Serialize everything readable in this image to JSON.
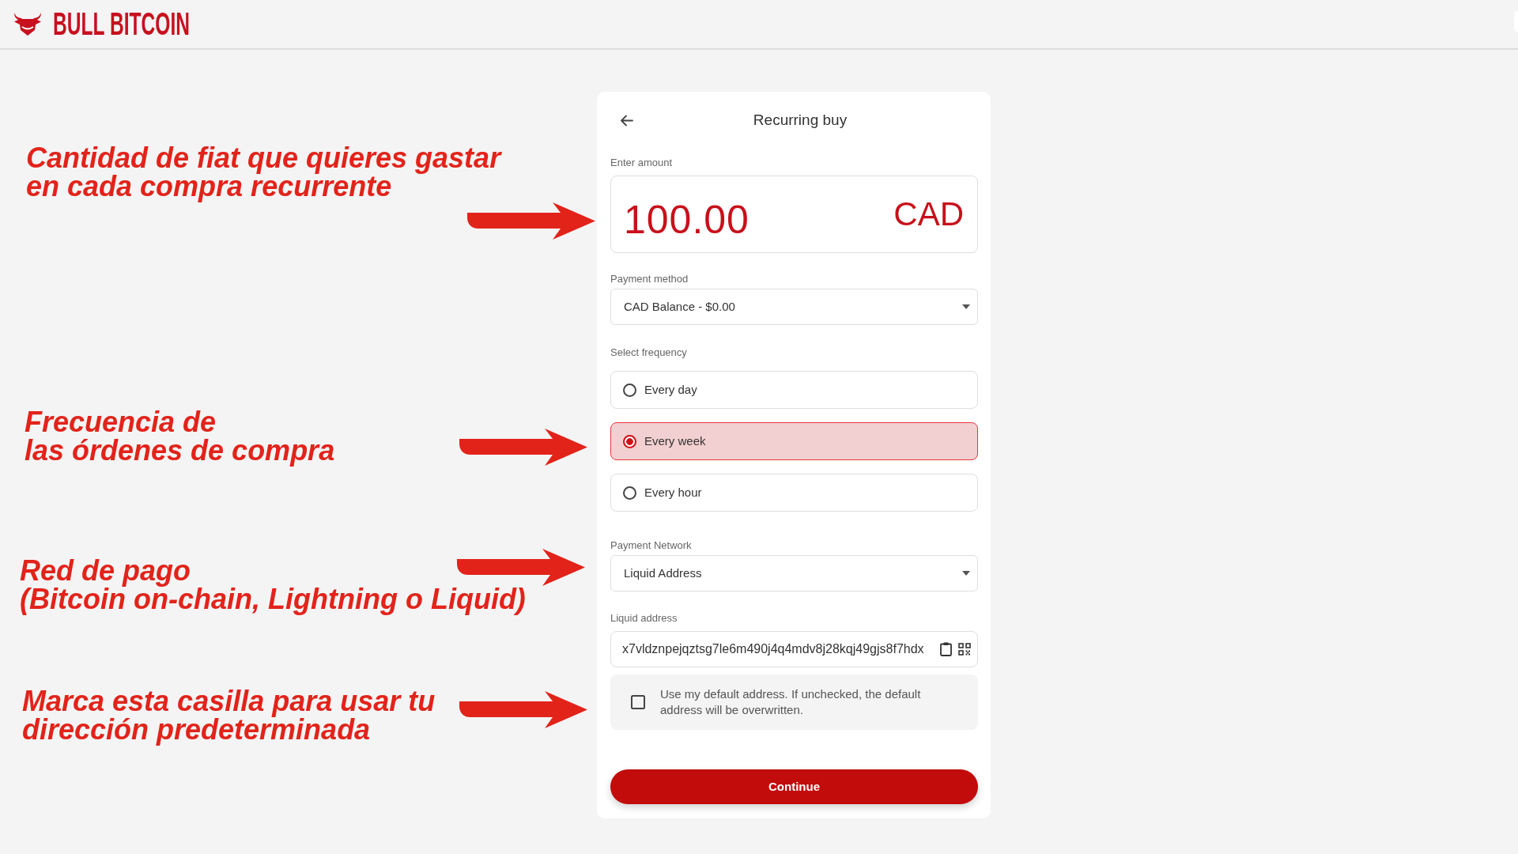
{
  "header": {
    "brand": "BULL BITCOIN"
  },
  "annotations": [
    {
      "text": "Cantidad de fiat que quieres gastar\nen cada compra recurrente"
    },
    {
      "text": "Frecuencia de\nlas órdenes de compra"
    },
    {
      "text": "Red de pago\n(Bitcoin on-chain, Lightning o Liquid)"
    },
    {
      "text": "Marca esta casilla para usar tu\ndirección predeterminada"
    }
  ],
  "form": {
    "title": "Recurring buy",
    "amount": {
      "label": "Enter amount",
      "value": "100.00",
      "currency": "CAD"
    },
    "payment_method": {
      "label": "Payment method",
      "value": "CAD Balance - $0.00"
    },
    "frequency": {
      "label": "Select frequency",
      "options": [
        {
          "label": "Every day",
          "selected": false
        },
        {
          "label": "Every week",
          "selected": true
        },
        {
          "label": "Every hour",
          "selected": false
        }
      ]
    },
    "payment_network": {
      "label": "Payment Network",
      "value": "Liquid Address"
    },
    "address": {
      "label": "Liquid address",
      "value": "x7vldznpejqztsg7le6m490j4q4mdv8j28kqj49gjs8f7hdx"
    },
    "default_address": {
      "label": "Use my default address. If unchecked, the default address will be overwritten.",
      "checked": false
    },
    "submit": "Continue"
  }
}
